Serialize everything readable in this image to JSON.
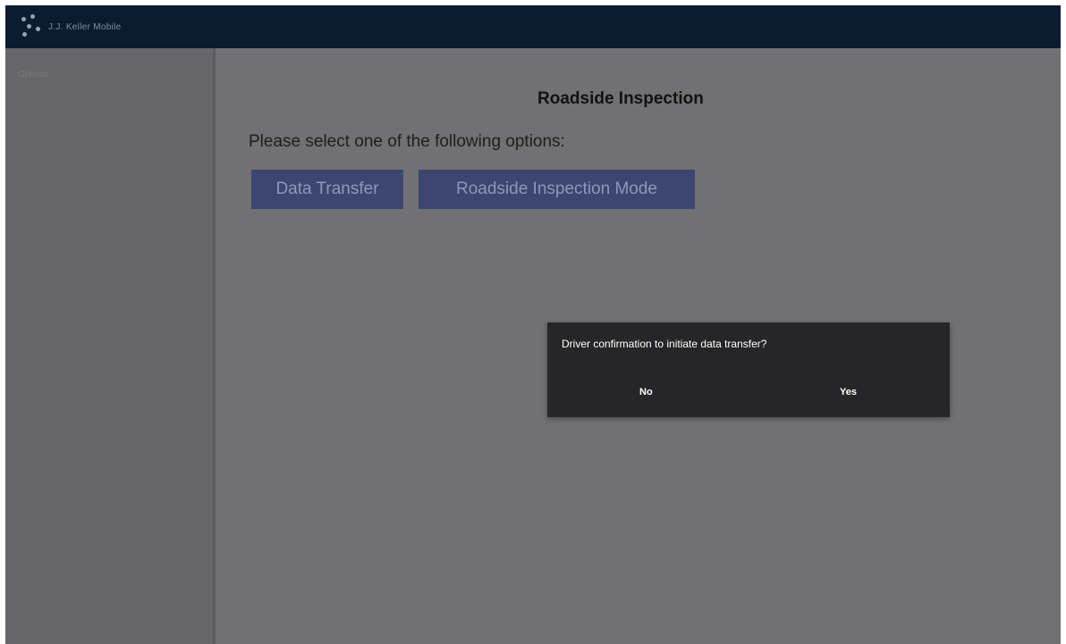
{
  "app": {
    "name": "J.J. Keller Mobile",
    "logo_icon": "logo-icon"
  },
  "sidebar": {
    "items": [
      {
        "label": "Options"
      }
    ]
  },
  "main": {
    "title": "Roadside Inspection",
    "prompt": "Please select one of the following options:",
    "buttons": {
      "data_transfer": "Data Transfer",
      "roadside_mode": "Roadside Inspection Mode"
    }
  },
  "dialog": {
    "message": "Driver confirmation to initiate data transfer?",
    "no_label": "No",
    "yes_label": "Yes"
  },
  "colors": {
    "topbar": "#0d1b30",
    "overlay_bg": "#6e6e70",
    "button_bg": "#3c4670",
    "dialog_bg": "#262628"
  }
}
